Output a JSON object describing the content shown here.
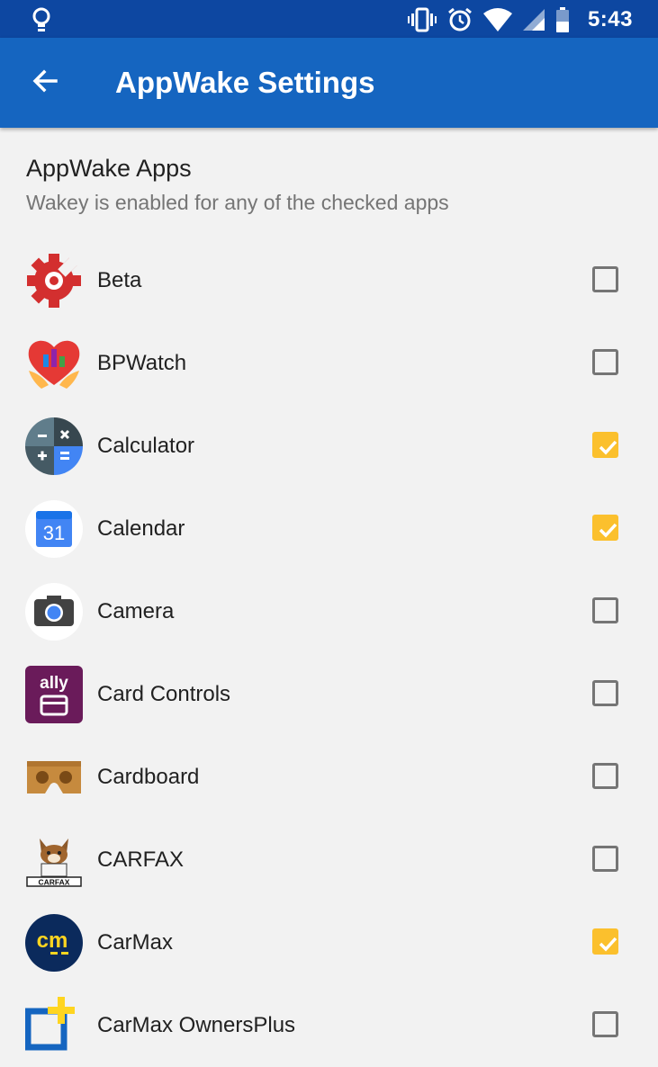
{
  "status_bar": {
    "time": "5:43",
    "icons": [
      "lightbulb-icon",
      "vibrate-icon",
      "alarm-icon",
      "wifi-icon",
      "cell-signal-icon",
      "battery-icon"
    ]
  },
  "app_bar": {
    "title": "AppWake Settings",
    "back_icon": "arrow-back-icon",
    "color": "#1565c0"
  },
  "section": {
    "title": "AppWake Apps",
    "subtitle": "Wakey is enabled for any of the checked apps"
  },
  "apps": [
    {
      "label": "Beta",
      "icon": "beta-gear-icon",
      "checked": false
    },
    {
      "label": "BPWatch",
      "icon": "bpwatch-heart-icon",
      "checked": false
    },
    {
      "label": "Calculator",
      "icon": "calculator-icon",
      "checked": true
    },
    {
      "label": "Calendar",
      "icon": "calendar-icon",
      "checked": true,
      "icon_text": "31"
    },
    {
      "label": "Camera",
      "icon": "camera-icon",
      "checked": false
    },
    {
      "label": "Card Controls",
      "icon": "ally-card-icon",
      "checked": false,
      "icon_text": "ally"
    },
    {
      "label": "Cardboard",
      "icon": "cardboard-icon",
      "checked": false
    },
    {
      "label": "CARFAX",
      "icon": "carfax-fox-icon",
      "checked": false,
      "icon_text": "CARFAX"
    },
    {
      "label": "CarMax",
      "icon": "carmax-icon",
      "checked": true,
      "icon_text": "cm"
    },
    {
      "label": "CarMax OwnersPlus",
      "icon": "carmax-ownersplus-icon",
      "checked": false
    }
  ],
  "colors": {
    "status_bar": "#0d47a1",
    "app_bar": "#1565c0",
    "checkbox_checked": "#fbc02d",
    "checkbox_unchecked": "#757575"
  }
}
